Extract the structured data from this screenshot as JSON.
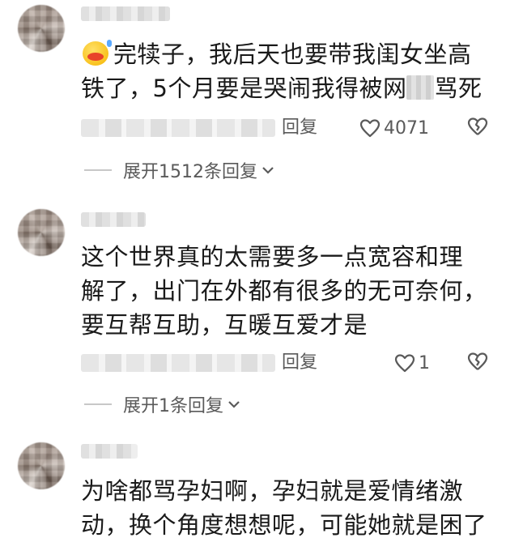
{
  "comments": [
    {
      "lines": [
        "完犊子，我后天也要带我闺女坐高",
        "铁了，5个月要是哭闹我得被网",
        "骂死"
      ],
      "reply_label": "回复",
      "likes": "4071",
      "expand_label": "展开1512条回复"
    },
    {
      "lines": [
        "这个世界真的太需要多一点宽容和理",
        "解了，出门在外都有很多的无可奈何，",
        "要互帮互助，互暖互爱才是"
      ],
      "reply_label": "回复",
      "likes": "1",
      "expand_label": "展开1条回复"
    },
    {
      "lines": [
        "为啥都骂孕妇啊，孕妇就是爱情绪激",
        "动，换个角度想想呢，可能她就是困了"
      ]
    }
  ],
  "icons": {
    "like": "heart-outline-icon",
    "dislike": "broken-heart-icon",
    "expand": "chevron-down-icon",
    "emoji": "duck-mouth-emoji-icon"
  },
  "colors": {
    "text": "#1a1a1a",
    "meta": "#5a5a5a",
    "emoji_face": "#f6b500",
    "emoji_mouth": "#e8432a"
  }
}
